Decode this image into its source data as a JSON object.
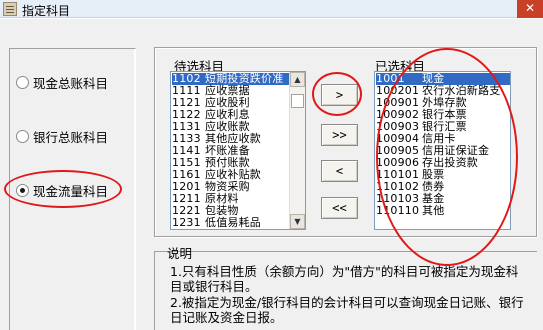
{
  "window": {
    "title": "指定科目",
    "close_label": "✕"
  },
  "left_options": [
    {
      "label": "现金总账科目",
      "checked": false
    },
    {
      "label": "银行总账科目",
      "checked": false
    },
    {
      "label": "现金流量科目",
      "checked": true
    }
  ],
  "candidate_list": {
    "caption": "待选科目",
    "items": [
      {
        "code": "1102",
        "name": "短期投资跌价准",
        "selected": true
      },
      {
        "code": "1111",
        "name": "应收票据",
        "selected": false
      },
      {
        "code": "1121",
        "name": "应收股利",
        "selected": false
      },
      {
        "code": "1122",
        "name": "应收利息",
        "selected": false
      },
      {
        "code": "1131",
        "name": "应收账款",
        "selected": false
      },
      {
        "code": "1133",
        "name": "其他应收款",
        "selected": false
      },
      {
        "code": "1141",
        "name": "坏账准备",
        "selected": false
      },
      {
        "code": "1151",
        "name": "预付账款",
        "selected": false
      },
      {
        "code": "1161",
        "name": "应收补贴款",
        "selected": false
      },
      {
        "code": "1201",
        "name": "物资采购",
        "selected": false
      },
      {
        "code": "1211",
        "name": "原材料",
        "selected": false
      },
      {
        "code": "1221",
        "name": "包装物",
        "selected": false
      },
      {
        "code": "1231",
        "name": "低值易耗品",
        "selected": false
      }
    ]
  },
  "selected_list": {
    "caption": "已选科目",
    "items": [
      {
        "code": "1001",
        "name": "现金",
        "selected": true
      },
      {
        "code": "100201",
        "name": "农行水泊新路支",
        "selected": false
      },
      {
        "code": "100901",
        "name": "外埠存款",
        "selected": false
      },
      {
        "code": "100902",
        "name": "银行本票",
        "selected": false
      },
      {
        "code": "100903",
        "name": "银行汇票",
        "selected": false
      },
      {
        "code": "100904",
        "name": "信用卡",
        "selected": false
      },
      {
        "code": "100905",
        "name": "信用证保证金",
        "selected": false
      },
      {
        "code": "100906",
        "name": "存出投资款",
        "selected": false
      },
      {
        "code": "110101",
        "name": "股票",
        "selected": false
      },
      {
        "code": "110102",
        "name": "债券",
        "selected": false
      },
      {
        "code": "110103",
        "name": "基金",
        "selected": false
      },
      {
        "code": "110110",
        "name": "其他",
        "selected": false
      }
    ]
  },
  "buttons": {
    "add_one": ">",
    "add_all": ">>",
    "remove_one": "<",
    "remove_all": "<<"
  },
  "notes": {
    "title": "说明",
    "line1": "1.只有科目性质（余额方向）为\"借方\"的科目可被指定为现金科",
    "line2": "目或银行科目。",
    "line3": "2.被指定为现金/银行科目的会计科目可以查询现金日记账、银行",
    "line4": "日记账及资金日报。"
  },
  "colors": {
    "selection": "#316ac5",
    "annotation_circle": "#e01818"
  }
}
